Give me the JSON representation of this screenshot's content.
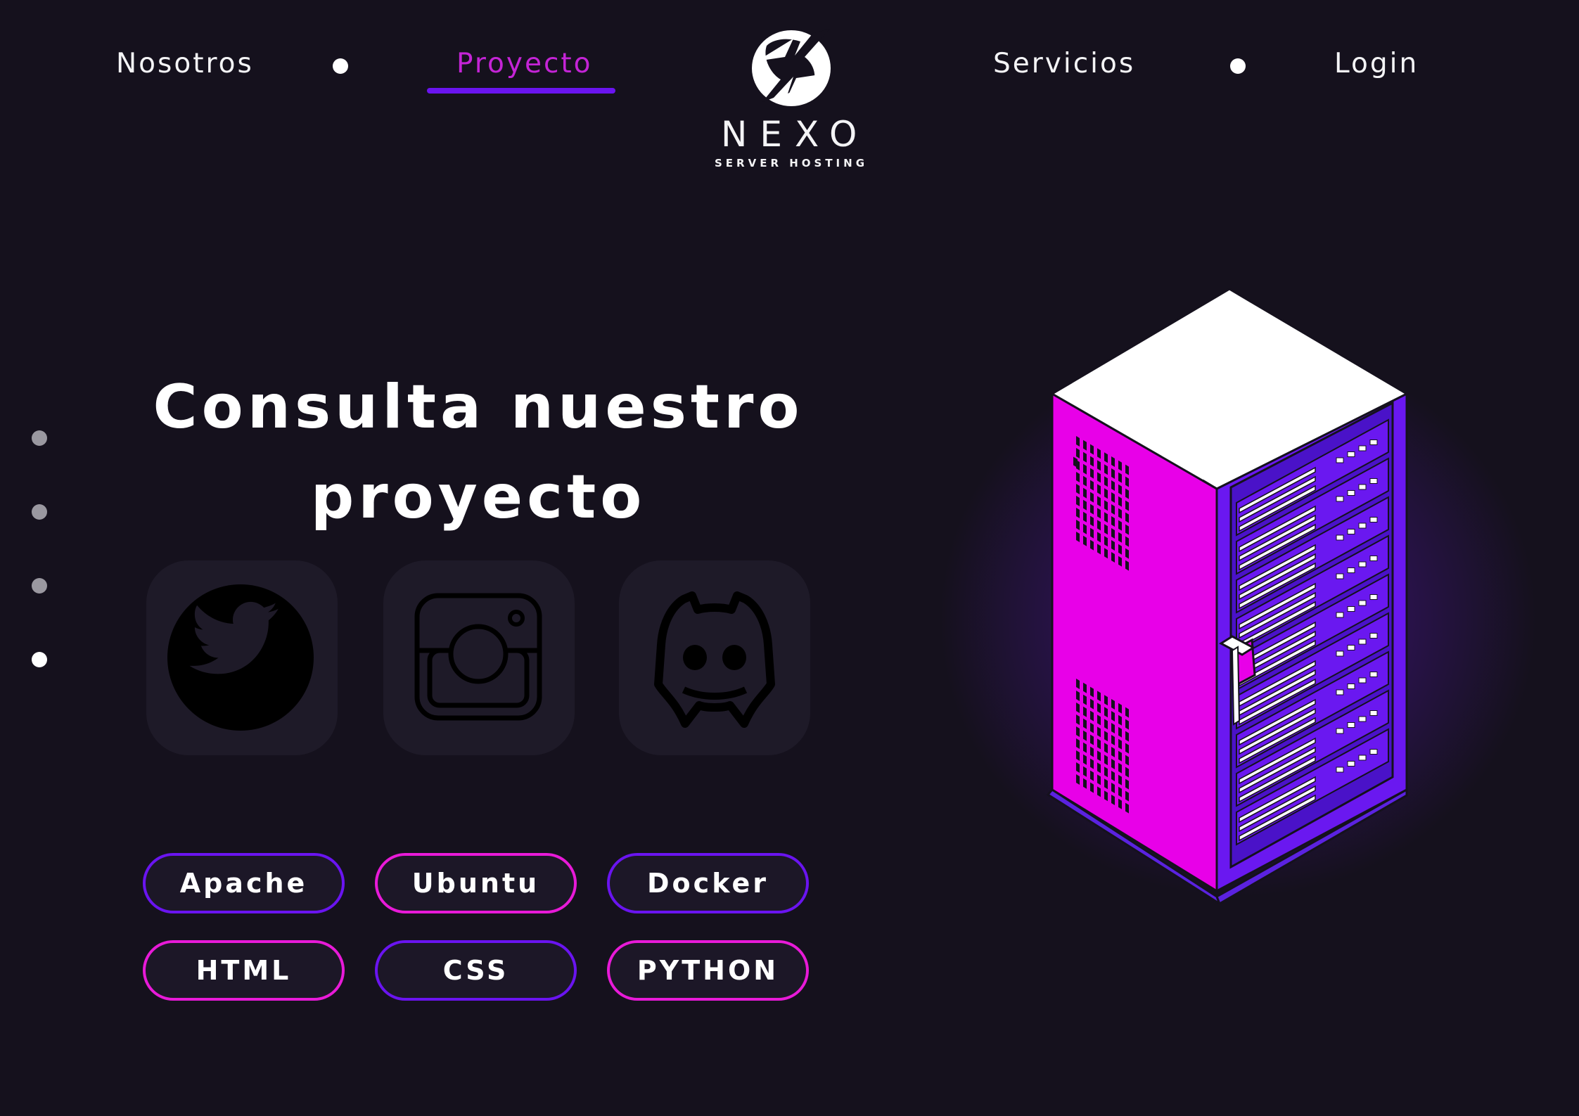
{
  "nav": {
    "items": [
      {
        "label": "Nosotros"
      },
      {
        "label": "Proyecto",
        "active": true
      },
      {
        "label": "Servicios"
      },
      {
        "label": "Login"
      }
    ]
  },
  "logo": {
    "word": "NEXO",
    "subtitle": "SERVER HOSTING"
  },
  "hero": {
    "title_line1": "Consulta nuestro",
    "title_line2": "proyecto"
  },
  "social": [
    {
      "icon": "twitter-icon"
    },
    {
      "icon": "instagram-icon"
    },
    {
      "icon": "discord-icon"
    }
  ],
  "tags": [
    {
      "label": "Apache",
      "color": "#6a14f0"
    },
    {
      "label": "Ubuntu",
      "color": "#e81ad8"
    },
    {
      "label": "Docker",
      "color": "#6a14f0"
    },
    {
      "label": "HTML",
      "color": "#e81ad8"
    },
    {
      "label": "CSS",
      "color": "#6a14f0"
    },
    {
      "label": "PYTHON",
      "color": "#e81ad8"
    }
  ],
  "side_pager": {
    "count": 4,
    "active_index": 3
  },
  "colors": {
    "background": "#15111d",
    "accent_purple": "#6a14f0",
    "accent_magenta": "#e81ad8",
    "active_nav": "#c424d6"
  },
  "illustration": "server-rack-icon"
}
